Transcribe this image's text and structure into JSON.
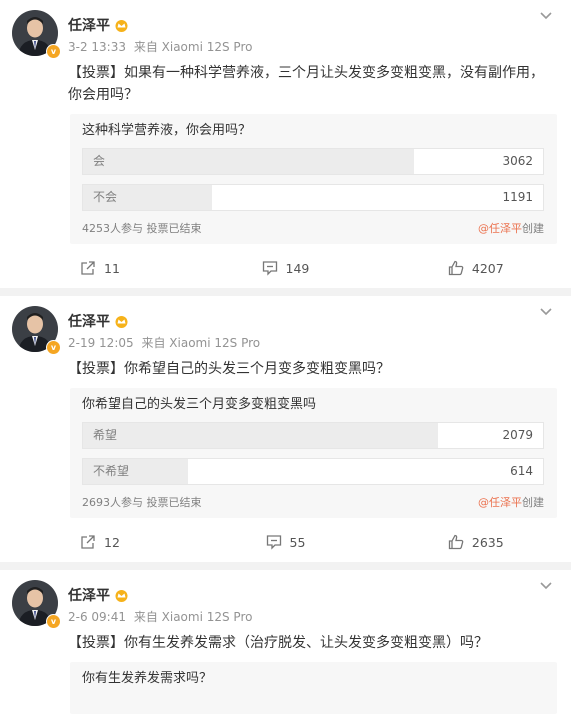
{
  "posts": [
    {
      "author": "任泽平",
      "meta_time": "3-2 13:33",
      "meta_source": "来自 Xiaomi 12S Pro",
      "text": "【投票】如果有一种科学营养液，三个月让头发变多变粗变黑，没有副作用，你会用吗？",
      "poll": {
        "question": "这种科学营养液，你会用吗？",
        "options": [
          {
            "label": "会",
            "count": "3062",
            "share": 0.72
          },
          {
            "label": "不会",
            "count": "1191",
            "share": 0.28
          }
        ],
        "summary": "4253人参与 投票已结束",
        "creator_handle": "@任泽平",
        "creator_suffix": "创建"
      },
      "actions": {
        "repost": "11",
        "comment": "149",
        "like": "4207"
      }
    },
    {
      "author": "任泽平",
      "meta_time": "2-19 12:05",
      "meta_source": "来自 Xiaomi 12S Pro",
      "text": "【投票】你希望自己的头发三个月变多变粗变黑吗？",
      "poll": {
        "question": "你希望自己的头发三个月变多变粗变黑吗",
        "options": [
          {
            "label": "希望",
            "count": "2079",
            "share": 0.772
          },
          {
            "label": "不希望",
            "count": "614",
            "share": 0.228
          }
        ],
        "summary": "2693人参与 投票已结束",
        "creator_handle": "@任泽平",
        "creator_suffix": "创建"
      },
      "actions": {
        "repost": "12",
        "comment": "55",
        "like": "2635"
      }
    },
    {
      "author": "任泽平",
      "meta_time": "2-6 09:41",
      "meta_source": "来自 Xiaomi 12S Pro",
      "text": "【投票】你有生发养发需求（治疗脱发、让头发变多变粗变黑）吗？",
      "poll": {
        "question": "你有生发养发需求吗？"
      }
    }
  ],
  "colors": {
    "accent": "#eb7350",
    "verified": "#f5a623"
  },
  "icons": {
    "more": "chevron-down-icon",
    "repost": "repost-icon",
    "comment": "comment-icon",
    "like": "thumbs-up-icon",
    "crown": "crown-icon"
  }
}
